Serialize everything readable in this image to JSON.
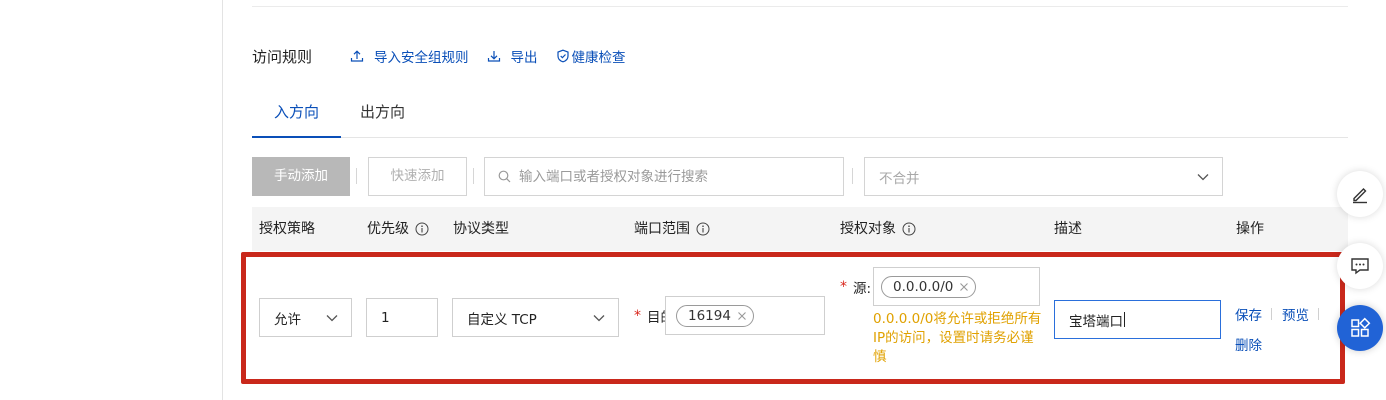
{
  "section": {
    "title": "访问规则",
    "import_label": "导入安全组规则",
    "export_label": "导出",
    "health_label": "健康检查"
  },
  "tabs": [
    {
      "label": "入方向",
      "active": true
    },
    {
      "label": "出方向",
      "active": false
    }
  ],
  "toolbar": {
    "manual_add": "手动添加",
    "quick_add": "快速添加",
    "search_placeholder": "输入端口或者授权对象进行搜索",
    "merge_value": "不合并"
  },
  "table": {
    "headers": [
      "授权策略",
      "优先级",
      "协议类型",
      "端口范围",
      "授权对象",
      "描述",
      "操作"
    ]
  },
  "row": {
    "policy": "允许",
    "priority": "1",
    "protocol": "自定义 TCP",
    "port_label": "目的",
    "port_tag": "16194",
    "source_label": "源:",
    "source_tag": "0.0.0.0/0",
    "warning": "0.0.0.0/0将允许或拒绝所有IP的访问，设置时请务必谨慎",
    "description": "宝塔端口",
    "ops": {
      "save": "保存",
      "preview": "预览",
      "delete": "删除"
    }
  },
  "colors": {
    "link_blue": "#0a4fb8",
    "warning": "#e0a100",
    "required": "#d9261c",
    "highlight": "#c9281b",
    "float_blue": "#2163d6"
  },
  "icons": [
    "upload-icon",
    "download-icon",
    "shield-check-icon",
    "search-icon",
    "chevron-down-icon",
    "info-icon",
    "close-icon",
    "edit-icon",
    "chat-icon",
    "apps-icon"
  ]
}
